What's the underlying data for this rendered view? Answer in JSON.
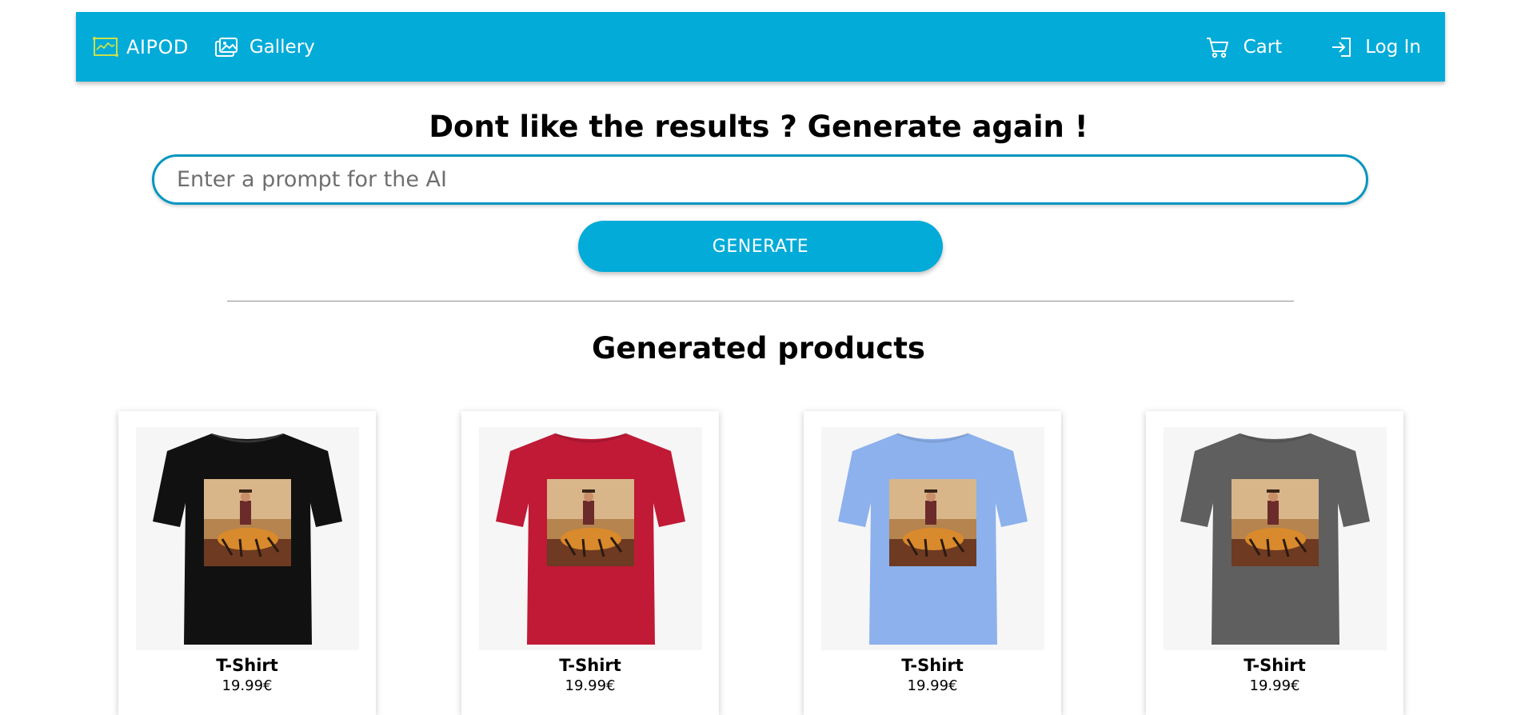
{
  "navbar": {
    "brand_label": "AIPOD",
    "gallery_label": "Gallery",
    "cart_label": "Cart",
    "login_label": "Log In",
    "bg_color": "#02abd8",
    "logo_color": "#c8e04a"
  },
  "generator": {
    "headline": "Dont like the results ? Generate again !",
    "prompt_placeholder": "Enter a prompt for the AI",
    "prompt_value": "",
    "generate_label": "GENERATE"
  },
  "products": {
    "section_title": "Generated products",
    "items": [
      {
        "name": "T-Shirt",
        "price": "19.99€",
        "shirt_color": "#111111",
        "icon": "t-shirt-print-image"
      },
      {
        "name": "T-Shirt",
        "price": "19.99€",
        "shirt_color": "#c01a36",
        "icon": "t-shirt-print-image"
      },
      {
        "name": "T-Shirt",
        "price": "19.99€",
        "shirt_color": "#8cb1ec",
        "icon": "t-shirt-print-image"
      },
      {
        "name": "T-Shirt",
        "price": "19.99€",
        "shirt_color": "#5f5f5f",
        "icon": "t-shirt-print-image"
      }
    ]
  }
}
